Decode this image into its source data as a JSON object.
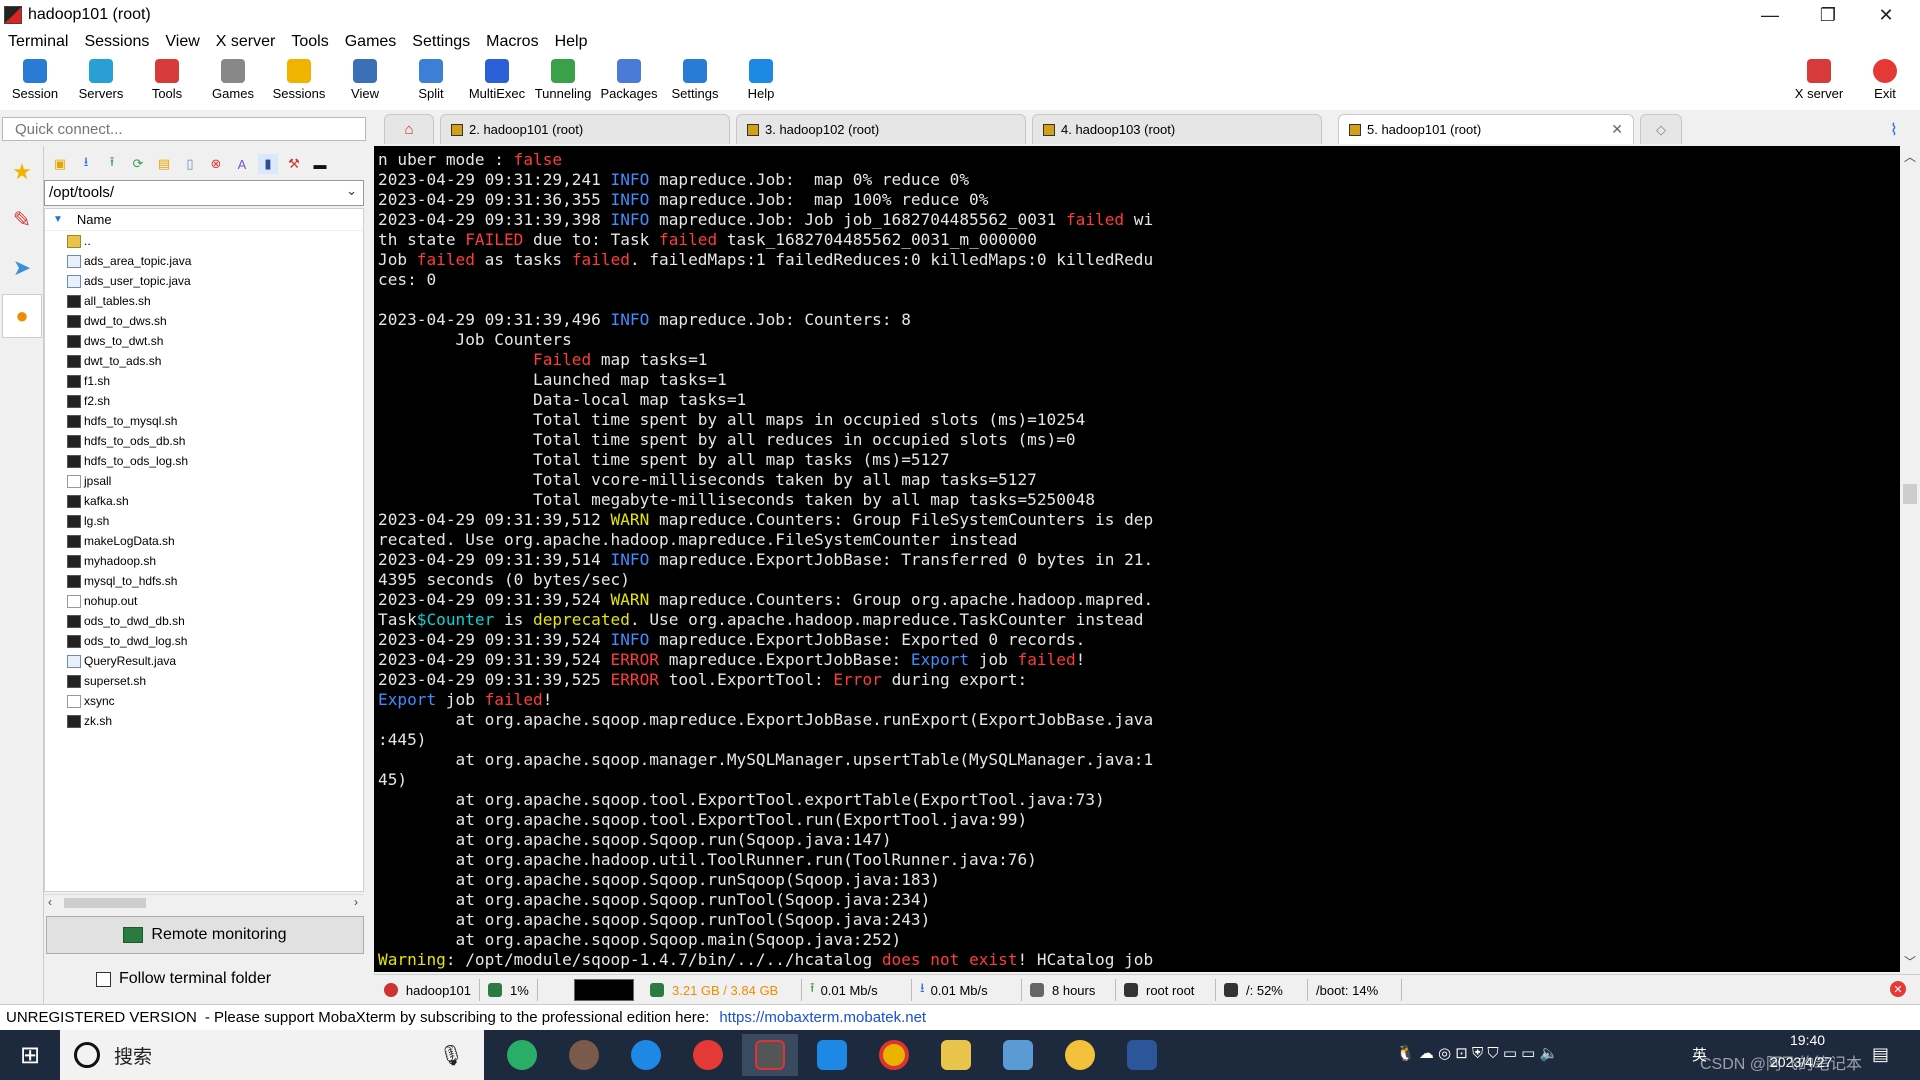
{
  "window": {
    "title": "hadoop101 (root)",
    "min": "—",
    "max": "❐",
    "close": "✕"
  },
  "menu": [
    "Terminal",
    "Sessions",
    "View",
    "X server",
    "Tools",
    "Games",
    "Settings",
    "Macros",
    "Help"
  ],
  "toolbar": [
    {
      "label": "Session",
      "color": "#2a7bd6"
    },
    {
      "label": "Servers",
      "color": "#2a9fd6"
    },
    {
      "label": "Tools",
      "color": "#d63a3a"
    },
    {
      "label": "Games",
      "color": "#888888"
    },
    {
      "label": "Sessions",
      "color": "#f0b400"
    },
    {
      "label": "View",
      "color": "#3b6fb6"
    },
    {
      "label": "Split",
      "color": "#3b7fd6"
    },
    {
      "label": "MultiExec",
      "color": "#2a5fd6"
    },
    {
      "label": "Tunneling",
      "color": "#3aa04a"
    },
    {
      "label": "Packages",
      "color": "#4a7bd6"
    },
    {
      "label": "Settings",
      "color": "#2a7bd6"
    },
    {
      "label": "Help",
      "color": "#1e88e5"
    }
  ],
  "toolbar_right": [
    {
      "label": "X server",
      "color": "#d63a3a"
    },
    {
      "label": "Exit",
      "color": "#e53935"
    }
  ],
  "quick_connect": {
    "placeholder": "Quick connect..."
  },
  "tabs": [
    {
      "label": "2. hadoop101 (root)"
    },
    {
      "label": "3. hadoop102 (root)"
    },
    {
      "label": "4. hadoop103 (root)"
    },
    {
      "label": "5. hadoop101 (root)"
    }
  ],
  "sftp": {
    "path": "/opt/tools/",
    "column_name": "Name",
    "files": [
      {
        "name": "..",
        "type": "dir"
      },
      {
        "name": "ads_area_topic.java",
        "type": "java"
      },
      {
        "name": "ads_user_topic.java",
        "type": "java"
      },
      {
        "name": "all_tables.sh",
        "type": "sh"
      },
      {
        "name": "dwd_to_dws.sh",
        "type": "sh"
      },
      {
        "name": "dws_to_dwt.sh",
        "type": "sh"
      },
      {
        "name": "dwt_to_ads.sh",
        "type": "sh"
      },
      {
        "name": "f1.sh",
        "type": "sh"
      },
      {
        "name": "f2.sh",
        "type": "sh"
      },
      {
        "name": "hdfs_to_mysql.sh",
        "type": "sh"
      },
      {
        "name": "hdfs_to_ods_db.sh",
        "type": "sh"
      },
      {
        "name": "hdfs_to_ods_log.sh",
        "type": "sh"
      },
      {
        "name": "jpsall",
        "type": "doc"
      },
      {
        "name": "kafka.sh",
        "type": "sh"
      },
      {
        "name": "lg.sh",
        "type": "sh"
      },
      {
        "name": "makeLogData.sh",
        "type": "sh"
      },
      {
        "name": "myhadoop.sh",
        "type": "sh"
      },
      {
        "name": "mysql_to_hdfs.sh",
        "type": "sh"
      },
      {
        "name": "nohup.out",
        "type": "doc"
      },
      {
        "name": "ods_to_dwd_db.sh",
        "type": "sh"
      },
      {
        "name": "ods_to_dwd_log.sh",
        "type": "sh"
      },
      {
        "name": "QueryResult.java",
        "type": "java"
      },
      {
        "name": "superset.sh",
        "type": "sh"
      },
      {
        "name": "xsync",
        "type": "doc"
      },
      {
        "name": "zk.sh",
        "type": "sh"
      }
    ],
    "remote_monitoring": "Remote monitoring",
    "follow_terminal_folder": "Follow terminal folder"
  },
  "terminal_lines": [
    [
      [
        "n uber mode : ",
        ""
      ],
      [
        "false",
        "red"
      ]
    ],
    [
      [
        "2023-04-29 09:31:29,241 ",
        ""
      ],
      [
        "INFO",
        "blue"
      ],
      [
        " mapreduce.Job:  map 0% reduce 0%",
        ""
      ]
    ],
    [
      [
        "2023-04-29 09:31:36,355 ",
        ""
      ],
      [
        "INFO",
        "blue"
      ],
      [
        " mapreduce.Job:  map 100% reduce 0%",
        ""
      ]
    ],
    [
      [
        "2023-04-29 09:31:39,398 ",
        ""
      ],
      [
        "INFO",
        "blue"
      ],
      [
        " mapreduce.Job: Job job_1682704485562_0031 ",
        ""
      ],
      [
        "failed",
        "red"
      ],
      [
        " wi",
        ""
      ]
    ],
    [
      [
        "th state ",
        ""
      ],
      [
        "FAILED",
        "red"
      ],
      [
        " due to: Task ",
        ""
      ],
      [
        "failed",
        "red"
      ],
      [
        " task_1682704485562_0031_m_000000",
        ""
      ]
    ],
    [
      [
        "Job ",
        ""
      ],
      [
        "failed",
        "red"
      ],
      [
        " as tasks ",
        ""
      ],
      [
        "failed",
        "red"
      ],
      [
        ". failedMaps:1 failedReduces:0 killedMaps:0 killedRedu",
        ""
      ]
    ],
    [
      [
        "ces: 0",
        ""
      ]
    ],
    [
      [
        "",
        ""
      ]
    ],
    [
      [
        "2023-04-29 09:31:39,496 ",
        ""
      ],
      [
        "INFO",
        "blue"
      ],
      [
        " mapreduce.Job: Counters: 8",
        ""
      ]
    ],
    [
      [
        "        Job Counters",
        ""
      ]
    ],
    [
      [
        "                ",
        ""
      ],
      [
        "Failed",
        "red"
      ],
      [
        " map tasks=1",
        ""
      ]
    ],
    [
      [
        "                Launched map tasks=1",
        ""
      ]
    ],
    [
      [
        "                Data-local map tasks=1",
        ""
      ]
    ],
    [
      [
        "                Total time spent by all maps in occupied slots (ms)=10254",
        ""
      ]
    ],
    [
      [
        "                Total time spent by all reduces in occupied slots (ms)=0",
        ""
      ]
    ],
    [
      [
        "                Total time spent by all map tasks (ms)=5127",
        ""
      ]
    ],
    [
      [
        "                Total vcore-milliseconds taken by all map tasks=5127",
        ""
      ]
    ],
    [
      [
        "                Total megabyte-milliseconds taken by all map tasks=5250048",
        ""
      ]
    ],
    [
      [
        "2023-04-29 09:31:39,512 ",
        ""
      ],
      [
        "WARN",
        "yel"
      ],
      [
        " mapreduce.Counters: Group FileSystemCounters is dep",
        ""
      ]
    ],
    [
      [
        "recated. Use org.apache.hadoop.mapreduce.FileSystemCounter instead",
        ""
      ]
    ],
    [
      [
        "2023-04-29 09:31:39,514 ",
        ""
      ],
      [
        "INFO",
        "blue"
      ],
      [
        " mapreduce.ExportJobBase: Transferred 0 bytes in 21.",
        ""
      ]
    ],
    [
      [
        "4395 seconds (0 bytes/sec)",
        ""
      ]
    ],
    [
      [
        "2023-04-29 09:31:39,524 ",
        ""
      ],
      [
        "WARN",
        "yel"
      ],
      [
        " mapreduce.Counters: Group org.apache.hadoop.mapred.",
        ""
      ]
    ],
    [
      [
        "Task",
        ""
      ],
      [
        "$Counter",
        "cyan"
      ],
      [
        " is ",
        ""
      ],
      [
        "deprecated",
        "yel"
      ],
      [
        ". Use org.apache.hadoop.mapreduce.TaskCounter instead",
        ""
      ]
    ],
    [
      [
        "2023-04-29 09:31:39,524 ",
        ""
      ],
      [
        "INFO",
        "blue"
      ],
      [
        " mapreduce.ExportJobBase: Exported 0 records.",
        ""
      ]
    ],
    [
      [
        "2023-04-29 09:31:39,524 ",
        ""
      ],
      [
        "ERROR",
        "red"
      ],
      [
        " mapreduce.ExportJobBase: ",
        ""
      ],
      [
        "Export",
        "blue"
      ],
      [
        " job ",
        ""
      ],
      [
        "failed",
        "red"
      ],
      [
        "!",
        ""
      ]
    ],
    [
      [
        "2023-04-29 09:31:39,525 ",
        ""
      ],
      [
        "ERROR",
        "red"
      ],
      [
        " tool.ExportTool: ",
        ""
      ],
      [
        "Error",
        "red"
      ],
      [
        " during export:",
        ""
      ]
    ],
    [
      [
        "Export",
        "blue"
      ],
      [
        " job ",
        ""
      ],
      [
        "failed",
        "red"
      ],
      [
        "!",
        ""
      ]
    ],
    [
      [
        "        at org.apache.sqoop.mapreduce.ExportJobBase.runExport(ExportJobBase.java",
        ""
      ]
    ],
    [
      [
        ":445)",
        ""
      ]
    ],
    [
      [
        "        at org.apache.sqoop.manager.MySQLManager.upsertTable(MySQLManager.java:1",
        ""
      ]
    ],
    [
      [
        "45)",
        ""
      ]
    ],
    [
      [
        "        at org.apache.sqoop.tool.ExportTool.exportTable(ExportTool.java:73)",
        ""
      ]
    ],
    [
      [
        "        at org.apache.sqoop.tool.ExportTool.run(ExportTool.java:99)",
        ""
      ]
    ],
    [
      [
        "        at org.apache.sqoop.Sqoop.run(Sqoop.java:147)",
        ""
      ]
    ],
    [
      [
        "        at org.apache.hadoop.util.ToolRunner.run(ToolRunner.java:76)",
        ""
      ]
    ],
    [
      [
        "        at org.apache.sqoop.Sqoop.runSqoop(Sqoop.java:183)",
        ""
      ]
    ],
    [
      [
        "        at org.apache.sqoop.Sqoop.runTool(Sqoop.java:234)",
        ""
      ]
    ],
    [
      [
        "        at org.apache.sqoop.Sqoop.runTool(Sqoop.java:243)",
        ""
      ]
    ],
    [
      [
        "        at org.apache.sqoop.Sqoop.main(Sqoop.java:252)",
        ""
      ]
    ],
    [
      [
        "Warning",
        "yel"
      ],
      [
        ": /opt/module/sqoop-1.4.7/bin/../../hcatalog ",
        ""
      ],
      [
        "does not exist",
        "red"
      ],
      [
        "! HCatalog job",
        ""
      ]
    ]
  ],
  "status": {
    "host": "hadoop101",
    "cpu": "1%",
    "memory": "3.21 GB / 3.84 GB",
    "upload": "0.01 Mb/s",
    "download": "0.01 Mb/s",
    "uptime": "8 hours",
    "users": "root  root",
    "disk_root": "/: 52%",
    "disk_boot": "/boot: 14%"
  },
  "unregistered": {
    "label": "UNREGISTERED VERSION",
    "message": "-  Please support MobaXterm by subscribing to the professional edition here:",
    "link": "https://mobaxterm.mobatek.net"
  },
  "taskbar": {
    "search_label": "搜索",
    "ime": "英",
    "time": "19:40",
    "date": "2023/4/27",
    "watermark": "CSDN @阿飞的笔记本"
  }
}
